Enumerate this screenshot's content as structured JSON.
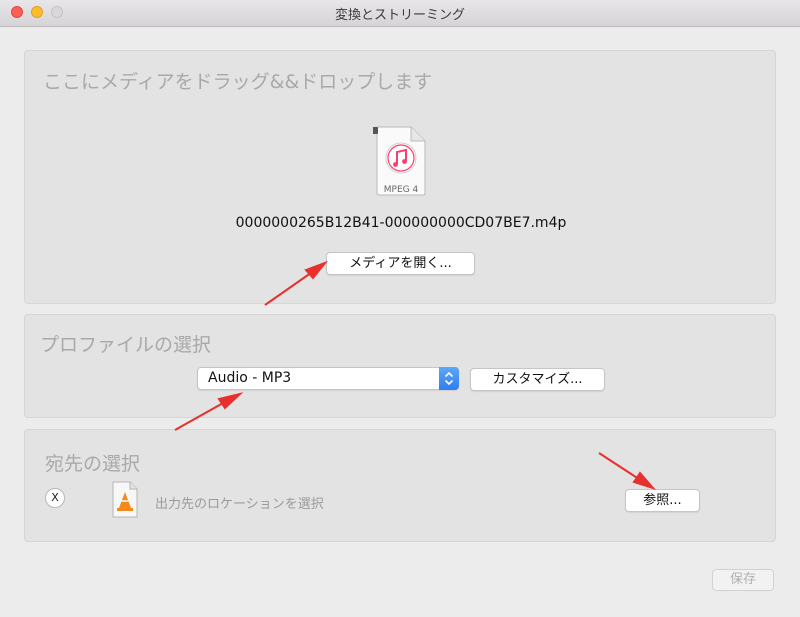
{
  "window": {
    "title": "変換とストリーミング"
  },
  "drop_section": {
    "title": "ここにメディアをドラッグ&&ドロップします",
    "file_icon": {
      "name": "music-file-icon",
      "badge": "MPEG 4"
    },
    "filename": "0000000265B12B41-000000000CD07BE7.m4p",
    "open_button": "メディアを開く..."
  },
  "profile_section": {
    "title": "プロファイルの選択",
    "selected_profile": "Audio - MP3",
    "customize_button": "カスタマイズ..."
  },
  "destination_section": {
    "title": "宛先の選択",
    "clear_button": "X",
    "location_label": "出力先のロケーションを選択",
    "browse_button": "参照..."
  },
  "footer": {
    "save_button": "保存"
  },
  "colors": {
    "accent_blue": "#2f7df2",
    "arrow_red": "#e8302f",
    "music_pink": "#fc3c6c"
  }
}
